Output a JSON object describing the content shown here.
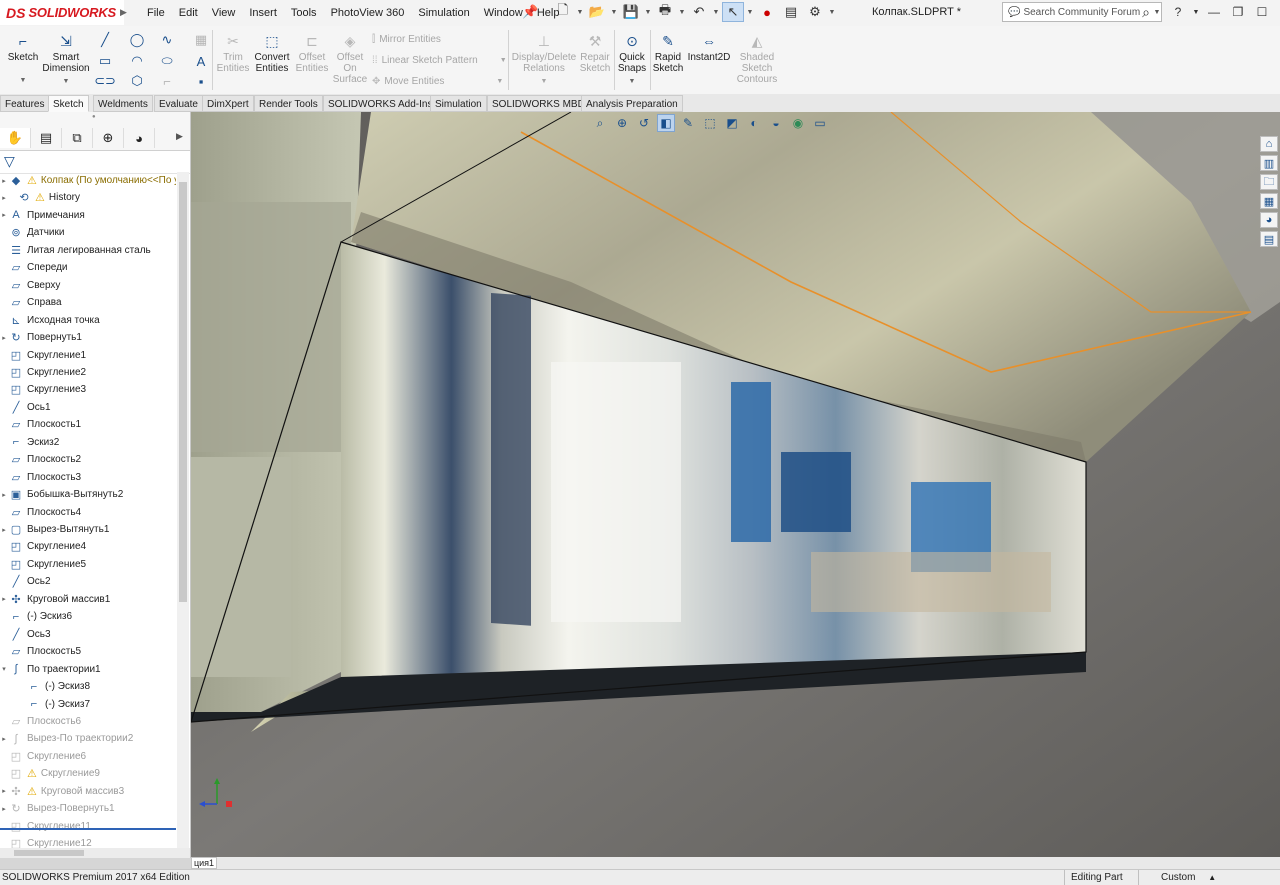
{
  "app": {
    "brand_ds": "DS",
    "brand_name": "SOLIDWORKS",
    "menu": [
      "File",
      "Edit",
      "View",
      "Insert",
      "Tools",
      "PhotoView 360",
      "Simulation",
      "Window",
      "Help"
    ],
    "document_title": "Колпак.SLDPRT *",
    "search_placeholder": "Search Community Forum",
    "help": "?"
  },
  "ribbon": {
    "sketch": "Sketch",
    "smart_dimension_1": "Smart",
    "smart_dimension_2": "Dimension",
    "trim_1": "Trim",
    "trim_2": "Entities",
    "convert_1": "Convert",
    "convert_2": "Entities",
    "offset_1": "Offset",
    "offset_2": "Entities",
    "offset_surface_1": "Offset",
    "offset_surface_2": "On",
    "offset_surface_3": "Surface",
    "mirror": "Mirror Entities",
    "linear_pattern": "Linear Sketch Pattern",
    "move": "Move Entities",
    "display_delete_1": "Display/Delete",
    "display_delete_2": "Relations",
    "repair_1": "Repair",
    "repair_2": "Sketch",
    "quick_snaps_1": "Quick",
    "quick_snaps_2": "Snaps",
    "rapid_1": "Rapid",
    "rapid_2": "Sketch",
    "instant2d": "Instant2D",
    "shaded_1": "Shaded",
    "shaded_2": "Sketch",
    "shaded_3": "Contours"
  },
  "tabs": [
    {
      "label": "Features"
    },
    {
      "label": "Sketch"
    },
    {
      "label": "Weldments"
    },
    {
      "label": "Evaluate"
    },
    {
      "label": "DimXpert"
    },
    {
      "label": "Render Tools"
    },
    {
      "label": "SOLIDWORKS Add-Ins"
    },
    {
      "label": "Simulation"
    },
    {
      "label": "SOLIDWORKS MBD"
    },
    {
      "label": "Analysis Preparation"
    }
  ],
  "active_tab": "Sketch",
  "tree": [
    {
      "label": "Колпак  (По умолчанию<<По у",
      "icon": "part-icon",
      "warn": true,
      "expand": "▸",
      "kind": "root"
    },
    {
      "label": "History",
      "icon": "history-icon",
      "warn": true,
      "expand": "▸",
      "kind": "root"
    },
    {
      "label": "Примечания",
      "icon": "annotations-icon",
      "warn": false,
      "expand": "▸",
      "kind": "normal"
    },
    {
      "label": "Датчики",
      "icon": "sensors-icon",
      "warn": false,
      "expand": "",
      "kind": "normal"
    },
    {
      "label": "Литая легированная сталь",
      "icon": "material-icon",
      "warn": false,
      "expand": "",
      "kind": "normal"
    },
    {
      "label": "Спереди",
      "icon": "plane-icon",
      "warn": false,
      "expand": "",
      "kind": "normal"
    },
    {
      "label": "Сверху",
      "icon": "plane-icon",
      "warn": false,
      "expand": "",
      "kind": "normal"
    },
    {
      "label": "Справа",
      "icon": "plane-icon",
      "warn": false,
      "expand": "",
      "kind": "normal"
    },
    {
      "label": "Исходная точка",
      "icon": "origin-icon",
      "warn": false,
      "expand": "",
      "kind": "normal"
    },
    {
      "label": "Повернуть1",
      "icon": "revolve-icon",
      "warn": false,
      "expand": "▸",
      "kind": "normal"
    },
    {
      "label": "Скругление1",
      "icon": "fillet-icon",
      "warn": false,
      "expand": "",
      "kind": "normal"
    },
    {
      "label": "Скругление2",
      "icon": "fillet-icon",
      "warn": false,
      "expand": "",
      "kind": "normal"
    },
    {
      "label": "Скругление3",
      "icon": "fillet-icon",
      "warn": false,
      "expand": "",
      "kind": "normal"
    },
    {
      "label": "Ось1",
      "icon": "axis-icon",
      "warn": false,
      "expand": "",
      "kind": "normal"
    },
    {
      "label": "Плоскость1",
      "icon": "plane-icon",
      "warn": false,
      "expand": "",
      "kind": "normal"
    },
    {
      "label": "Эскиз2",
      "icon": "sketch-icon",
      "warn": false,
      "expand": "",
      "kind": "normal"
    },
    {
      "label": "Плоскость2",
      "icon": "plane-icon",
      "warn": false,
      "expand": "",
      "kind": "normal"
    },
    {
      "label": "Плоскость3",
      "icon": "plane-icon",
      "warn": false,
      "expand": "",
      "kind": "normal"
    },
    {
      "label": "Бобышка-Вытянуть2",
      "icon": "extrude-icon",
      "warn": false,
      "expand": "▸",
      "kind": "normal"
    },
    {
      "label": "Плоскость4",
      "icon": "plane-icon",
      "warn": false,
      "expand": "",
      "kind": "normal"
    },
    {
      "label": "Вырез-Вытянуть1",
      "icon": "cut-extrude-icon",
      "warn": false,
      "expand": "▸",
      "kind": "normal"
    },
    {
      "label": "Скругление4",
      "icon": "fillet-icon",
      "warn": false,
      "expand": "",
      "kind": "normal"
    },
    {
      "label": "Скругление5",
      "icon": "fillet-icon",
      "warn": false,
      "expand": "",
      "kind": "normal"
    },
    {
      "label": "Ось2",
      "icon": "axis-icon",
      "warn": false,
      "expand": "",
      "kind": "normal"
    },
    {
      "label": "Круговой массив1",
      "icon": "circular-pattern-icon",
      "warn": false,
      "expand": "▸",
      "kind": "normal"
    },
    {
      "label": "(-) Эскиз6",
      "icon": "sketch-icon",
      "warn": false,
      "expand": "",
      "kind": "normal"
    },
    {
      "label": "Ось3",
      "icon": "axis-icon",
      "warn": false,
      "expand": "",
      "kind": "normal"
    },
    {
      "label": "Плоскость5",
      "icon": "plane-icon",
      "warn": false,
      "expand": "",
      "kind": "normal"
    },
    {
      "label": "По траектории1",
      "icon": "sweep-icon",
      "warn": false,
      "expand": "▾",
      "kind": "normal"
    },
    {
      "label": "(-) Эскиз8",
      "icon": "sketch-icon",
      "warn": false,
      "expand": "",
      "kind": "child"
    },
    {
      "label": "(-) Эскиз7",
      "icon": "sketch-icon",
      "warn": false,
      "expand": "",
      "kind": "child"
    },
    {
      "label": "Плоскость6",
      "icon": "plane-icon",
      "warn": false,
      "expand": "",
      "kind": "supp"
    },
    {
      "label": "Вырез-По траектории2",
      "icon": "cut-sweep-icon",
      "warn": false,
      "expand": "▸",
      "kind": "supp"
    },
    {
      "label": "Скругление6",
      "icon": "fillet-icon",
      "warn": false,
      "expand": "",
      "kind": "supp"
    },
    {
      "label": "Скругление9",
      "icon": "fillet-icon",
      "warn": true,
      "expand": "",
      "kind": "supp"
    },
    {
      "label": "Круговой массив3",
      "icon": "circular-pattern-icon",
      "warn": true,
      "expand": "▸",
      "kind": "supp"
    },
    {
      "label": "Вырез-Повернуть1",
      "icon": "cut-revolve-icon",
      "warn": false,
      "expand": "▸",
      "kind": "supp"
    },
    {
      "label": "Скругление11",
      "icon": "fillet-icon",
      "warn": false,
      "expand": "",
      "kind": "supp"
    },
    {
      "label": "Скругление12",
      "icon": "fillet-icon",
      "warn": false,
      "expand": "",
      "kind": "supp"
    }
  ],
  "model_tab": "ция1",
  "status": {
    "edition": "SOLIDWORKS Premium 2017 x64 Edition",
    "mode": "Editing Part",
    "units": "Custom"
  },
  "colors": {
    "brand": "#d71920",
    "accent": "#1a4f8c",
    "rollback_bar": "#2e63b6",
    "warning": "#e0a800",
    "edge_highlight": "#e8902a"
  }
}
